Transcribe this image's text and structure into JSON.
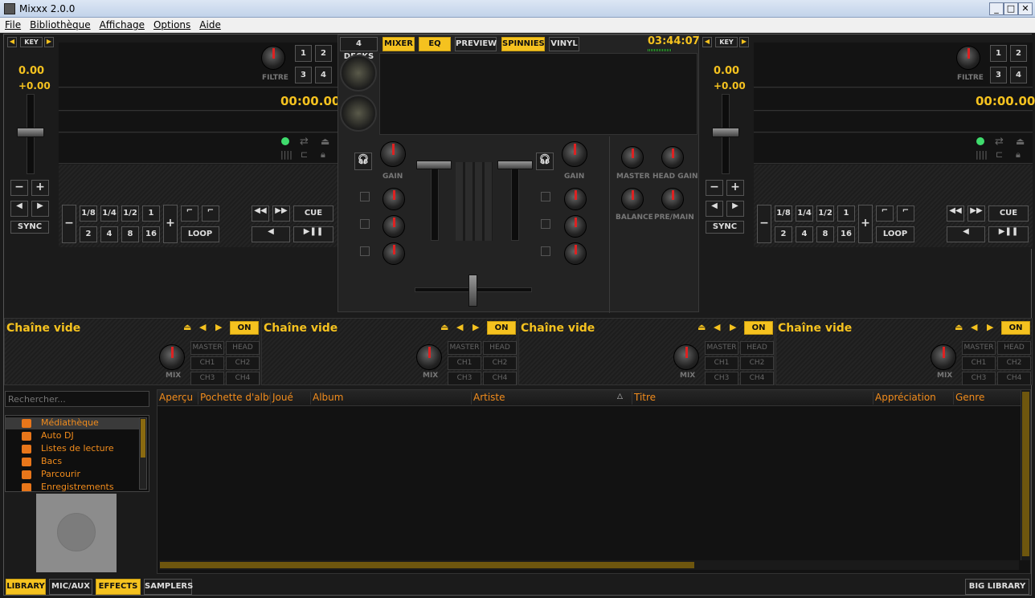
{
  "window": {
    "title": "Mixxx 2.0.0",
    "minimize": "_",
    "maximize": "□",
    "close": "✕"
  },
  "menu": [
    "File",
    "Bibliothèque",
    "Affichage",
    "Options",
    "Aide"
  ],
  "topbar": {
    "decks4": "4 DECKS",
    "mixer": "MIXER",
    "eq": "EQ",
    "preview": "PREVIEW",
    "spinnies": "SPINNIES",
    "vinyl": "VINYL",
    "clock": "03:44:07"
  },
  "deck_left": {
    "key": "KEY",
    "pitch": "0.00",
    "rate": "+0.00",
    "time": "00:00.00",
    "filtre": "FILTRE",
    "hot": [
      "1",
      "2",
      "3",
      "4"
    ],
    "sync": "SYNC",
    "loops_top": [
      "1/8",
      "1/4",
      "1/2",
      "1"
    ],
    "loops_bottom": [
      "2",
      "4",
      "8",
      "16"
    ],
    "loop": "LOOP",
    "cue": "CUE"
  },
  "deck_right": {
    "key": "KEY",
    "pitch": "0.00",
    "rate": "+0.00",
    "time": "00:00.00",
    "filtre": "FILTRE",
    "hot": [
      "1",
      "2",
      "3",
      "4"
    ],
    "sync": "SYNC",
    "loops_top": [
      "1/8",
      "1/4",
      "1/2",
      "1"
    ],
    "loops_bottom": [
      "2",
      "4",
      "8",
      "16"
    ],
    "loop": "LOOP",
    "cue": "CUE"
  },
  "mixer": {
    "gain_l": "GAIN",
    "gain_r": "GAIN",
    "master": "MASTER",
    "head_gain": "HEAD GAIN",
    "balance": "BALANCE",
    "pre_main": "PRE/MAIN"
  },
  "fx_units": [
    {
      "name": "Chaîne vide",
      "on": "ON",
      "mix": "MIX",
      "routes": [
        "MASTER",
        "HEAD",
        "CH1",
        "CH2",
        "CH3",
        "CH4"
      ]
    },
    {
      "name": "Chaîne vide",
      "on": "ON",
      "mix": "MIX",
      "routes": [
        "MASTER",
        "HEAD",
        "CH1",
        "CH2",
        "CH3",
        "CH4"
      ]
    },
    {
      "name": "Chaîne vide",
      "on": "ON",
      "mix": "MIX",
      "routes": [
        "MASTER",
        "HEAD",
        "CH1",
        "CH2",
        "CH3",
        "CH4"
      ]
    },
    {
      "name": "Chaîne vide",
      "on": "ON",
      "mix": "MIX",
      "routes": [
        "MASTER",
        "HEAD",
        "CH1",
        "CH2",
        "CH3",
        "CH4"
      ]
    }
  ],
  "library": {
    "search_placeholder": "Rechercher...",
    "tree": [
      "Médiathèque",
      "Auto DJ",
      "Listes de lecture",
      "Bacs",
      "Parcourir",
      "Enregistrements"
    ],
    "columns": [
      "Aperçu",
      "Pochette d'album",
      "Joué",
      "Album",
      "Artiste",
      "Titre",
      "Appréciation",
      "Genre"
    ]
  },
  "bottom_tabs": {
    "library": "LIBRARY",
    "mic": "MIC/AUX",
    "effects": "EFFECTS",
    "samplers": "SAMPLERS",
    "big": "BIG LIBRARY"
  }
}
